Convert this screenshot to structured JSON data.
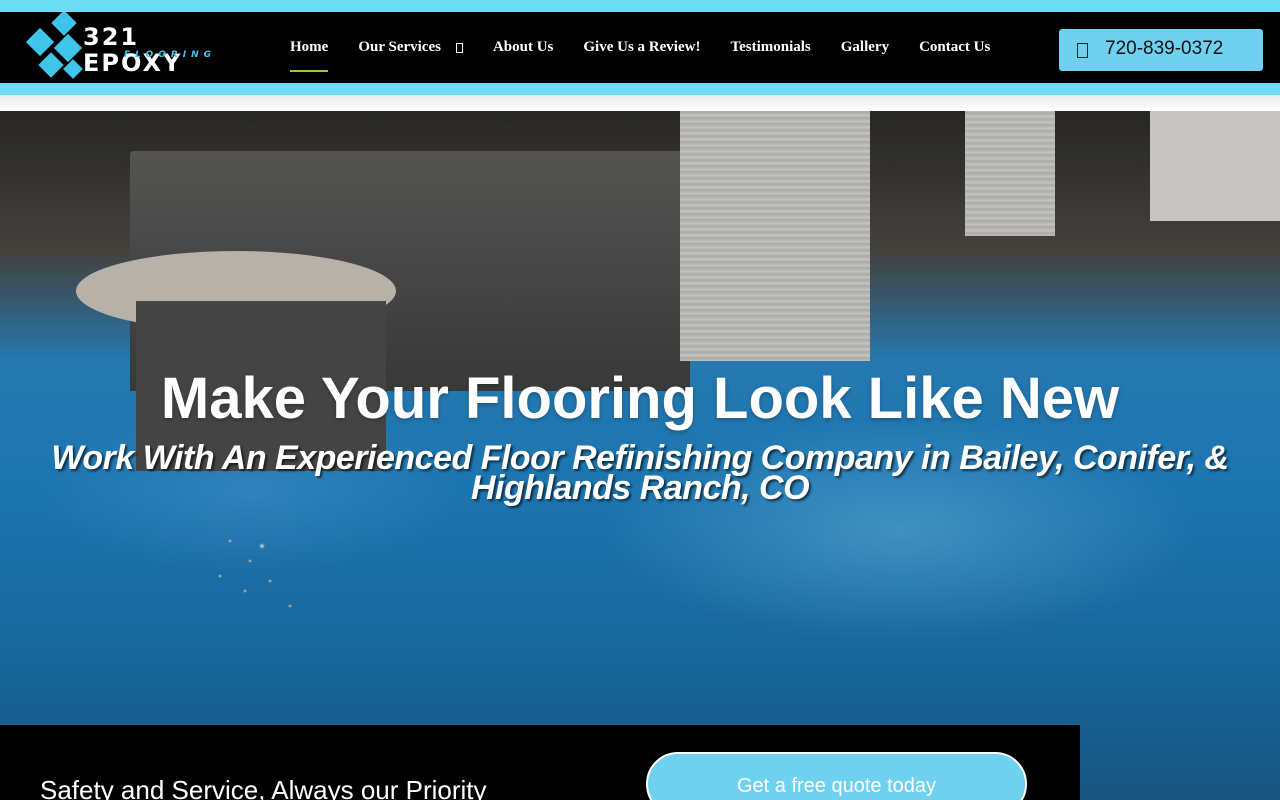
{
  "brand": {
    "name": "321 EPOXY",
    "tagline": "FLOORING",
    "accent_color": "#6fdcf5",
    "logo_diamond_color": "#3fc4ea"
  },
  "nav": {
    "items": [
      {
        "label": "Home",
        "active": true
      },
      {
        "label": "Our Services",
        "has_dropdown": true
      },
      {
        "label": "About Us"
      },
      {
        "label": "Give Us a Review!"
      },
      {
        "label": "Testimonials"
      },
      {
        "label": "Gallery"
      },
      {
        "label": "Contact Us"
      }
    ]
  },
  "phone": {
    "icon": "phone-icon",
    "number": "720-839-0372"
  },
  "hero": {
    "title": "Make Your Flooring Look Like New",
    "subtitle": "Work With An Experienced Floor Refinishing Company in Bailey, Conifer, & Highlands Ranch, CO"
  },
  "cta": {
    "text": "Safety and Service, Always our Priority",
    "button_label": "Get a free quote today"
  }
}
